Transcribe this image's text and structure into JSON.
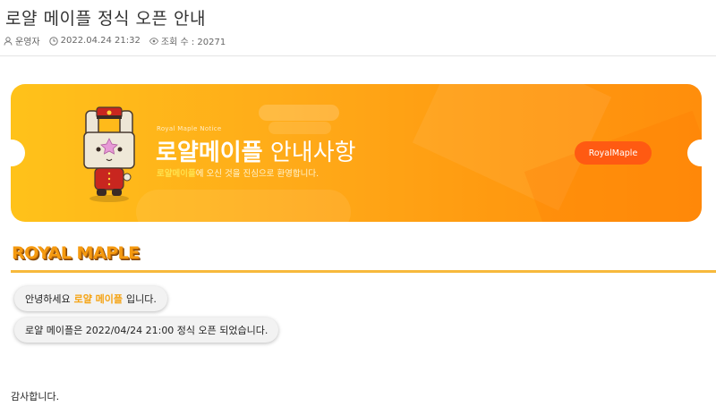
{
  "post": {
    "title": "로얄 메이플 정식 오픈 안내",
    "author": "운영자",
    "datetime": "2022.04.24 21:32",
    "views": "조회 수 : 20271"
  },
  "banner": {
    "subtitle": "Royal Maple Notice",
    "title_bold": "로얄메이플",
    "title_rest": "안내사항",
    "desc_highlight": "로얄메이플",
    "desc_rest": "에 오신 것을 진심으로 환영합니다.",
    "button": "RoyalMaple",
    "colors": {
      "start": "#ffc21a",
      "end": "#ff8e0c",
      "button": "#ff5a12"
    }
  },
  "section": {
    "heading": "ROYAL MAPLE",
    "heading_color": "#f59a10"
  },
  "messages": [
    {
      "before": "안녕하세요",
      "highlight": "로얄 메이플",
      "after": "입니다."
    },
    {
      "text": "로얄 메이플은 2022/04/24 21:00 정식 오픈 되었습니다."
    }
  ],
  "closing": "감사합니다.",
  "icons": {
    "author": "user-icon",
    "datetime": "clock-icon",
    "views": "eye-icon"
  }
}
